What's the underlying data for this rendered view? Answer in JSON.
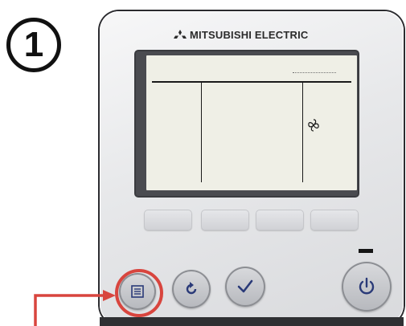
{
  "step": {
    "number": "1"
  },
  "controller": {
    "brand_name": "MITSUBISHI ELECTRIC",
    "brand_logo_icon": "three-diamond-logo-icon",
    "display": {
      "fan_icon": "fan-icon"
    },
    "softkeys": [
      {
        "id": "F1"
      },
      {
        "id": "F2"
      },
      {
        "id": "F3"
      },
      {
        "id": "F4"
      }
    ],
    "buttons": {
      "menu_icon": "menu-icon",
      "return_icon": "return-icon",
      "ok_icon": "check-icon",
      "power_icon": "power-icon"
    }
  },
  "annotation": {
    "highlight": "menu-button",
    "color": "#d8453e"
  },
  "colors": {
    "body": "#e7e8ea",
    "lcd_background": "#efefe6",
    "lcd_frame": "#4a4b50",
    "accent_red": "#d8453e"
  }
}
